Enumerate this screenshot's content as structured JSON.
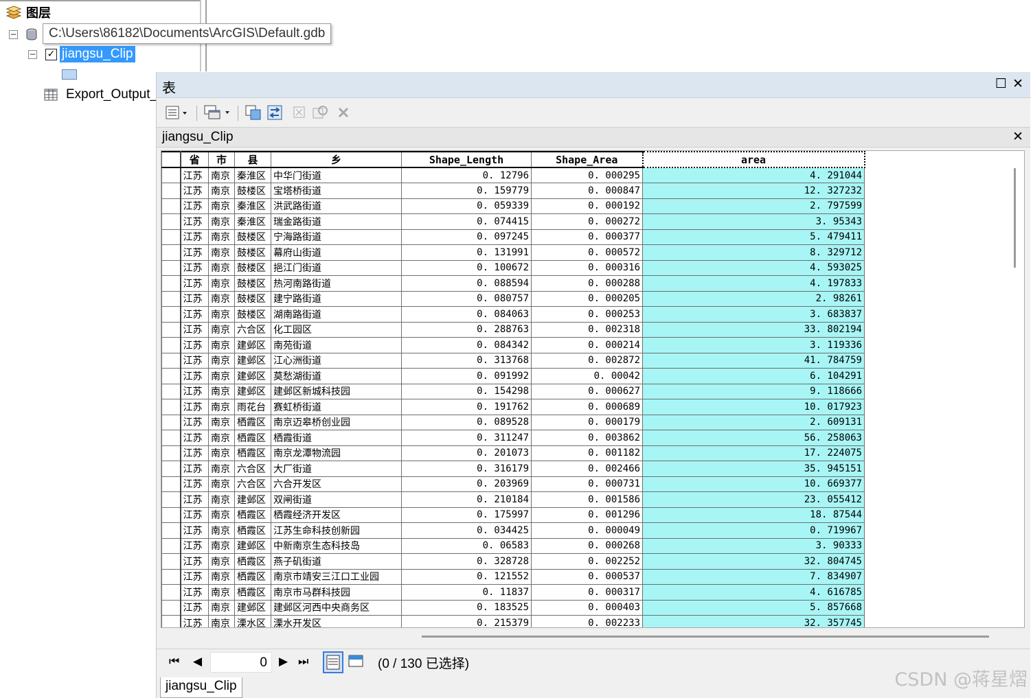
{
  "toc": {
    "title": "图层",
    "gdb_tooltip": "C:\\Users\\86182\\Documents\\ArcGIS\\Default.gdb",
    "layer_name": "jiangsu_Clip",
    "table_name": "Export_Output_",
    "collapse_glyph": "−",
    "check_glyph": "✓"
  },
  "window": {
    "title": "表",
    "maximize_glyph": "☐",
    "close_glyph": "✕",
    "tab_name": "jiangsu_Clip",
    "tab_close_glyph": "✕"
  },
  "toolbar": {
    "icons": [
      "table-options-icon",
      "related-tables-icon",
      "select-by-attributes-icon",
      "switch-selection-icon",
      "clear-selection-icon",
      "zoom-to-selected-icon",
      "delete-selected-icon"
    ]
  },
  "grid": {
    "columns": [
      "省",
      "市",
      "县",
      "乡",
      "Shape_Length",
      "Shape_Area",
      "area"
    ],
    "rows": [
      [
        "江苏",
        "南京",
        "秦淮区",
        "中华门街道",
        "0. 12796",
        "0. 000295",
        "4. 291044"
      ],
      [
        "江苏",
        "南京",
        "鼓楼区",
        "宝塔桥街道",
        "0. 159779",
        "0. 000847",
        "12. 327232"
      ],
      [
        "江苏",
        "南京",
        "秦淮区",
        "洪武路街道",
        "0. 059339",
        "0. 000192",
        "2. 797599"
      ],
      [
        "江苏",
        "南京",
        "秦淮区",
        "瑞金路街道",
        "0. 074415",
        "0. 000272",
        "3. 95343"
      ],
      [
        "江苏",
        "南京",
        "鼓楼区",
        "宁海路街道",
        "0. 097245",
        "0. 000377",
        "5. 479411"
      ],
      [
        "江苏",
        "南京",
        "鼓楼区",
        "幕府山街道",
        "0. 131991",
        "0. 000572",
        "8. 329712"
      ],
      [
        "江苏",
        "南京",
        "鼓楼区",
        "挹江门街道",
        "0. 100672",
        "0. 000316",
        "4. 593025"
      ],
      [
        "江苏",
        "南京",
        "鼓楼区",
        "热河南路街道",
        "0. 088594",
        "0. 000288",
        "4. 197833"
      ],
      [
        "江苏",
        "南京",
        "鼓楼区",
        "建宁路街道",
        "0. 080757",
        "0. 000205",
        "2. 98261"
      ],
      [
        "江苏",
        "南京",
        "鼓楼区",
        "湖南路街道",
        "0. 084063",
        "0. 000253",
        "3. 683837"
      ],
      [
        "江苏",
        "南京",
        "六合区",
        "化工园区",
        "0. 288763",
        "0. 002318",
        "33. 802194"
      ],
      [
        "江苏",
        "南京",
        "建邺区",
        "南苑街道",
        "0. 084342",
        "0. 000214",
        "3. 119336"
      ],
      [
        "江苏",
        "南京",
        "建邺区",
        "江心洲街道",
        "0. 313768",
        "0. 002872",
        "41. 784759"
      ],
      [
        "江苏",
        "南京",
        "建邺区",
        "莫愁湖街道",
        "0. 091992",
        "0. 00042",
        "6. 104291"
      ],
      [
        "江苏",
        "南京",
        "建邺区",
        "建邺区新城科技园",
        "0. 154298",
        "0. 000627",
        "9. 118666"
      ],
      [
        "江苏",
        "南京",
        "雨花台",
        "赛虹桥街道",
        "0. 191762",
        "0. 000689",
        "10. 017923"
      ],
      [
        "江苏",
        "南京",
        "栖霞区",
        "南京迈皋桥创业园",
        "0. 089528",
        "0. 000179",
        "2. 609131"
      ],
      [
        "江苏",
        "南京",
        "栖霞区",
        "栖霞街道",
        "0. 311247",
        "0. 003862",
        "56. 258063"
      ],
      [
        "江苏",
        "南京",
        "栖霞区",
        "南京龙潭物流园",
        "0. 201073",
        "0. 001182",
        "17. 224075"
      ],
      [
        "江苏",
        "南京",
        "六合区",
        "大厂街道",
        "0. 316179",
        "0. 002466",
        "35. 945151"
      ],
      [
        "江苏",
        "南京",
        "六合区",
        "六合开发区",
        "0. 203969",
        "0. 000731",
        "10. 669377"
      ],
      [
        "江苏",
        "南京",
        "建邺区",
        "双闸街道",
        "0. 210184",
        "0. 001586",
        "23. 055412"
      ],
      [
        "江苏",
        "南京",
        "栖霞区",
        "栖霞经济开发区",
        "0. 175997",
        "0. 001296",
        "18. 87544"
      ],
      [
        "江苏",
        "南京",
        "栖霞区",
        "江苏生命科技创新园",
        "0. 034425",
        "0. 000049",
        "0. 719967"
      ],
      [
        "江苏",
        "南京",
        "建邺区",
        "中新南京生态科技岛",
        "0. 06583",
        "0. 000268",
        "3. 90333"
      ],
      [
        "江苏",
        "南京",
        "栖霞区",
        "燕子矶街道",
        "0. 328728",
        "0. 002252",
        "32. 804745"
      ],
      [
        "江苏",
        "南京",
        "栖霞区",
        "南京市靖安三江口工业园",
        "0. 121552",
        "0. 000537",
        "7. 834907"
      ],
      [
        "江苏",
        "南京",
        "栖霞区",
        "南京市马群科技园",
        "0. 11837",
        "0. 000317",
        "4. 616785"
      ],
      [
        "江苏",
        "南京",
        "建邺区",
        "建邺区河西中央商务区",
        "0. 183525",
        "0. 000403",
        "5. 857668"
      ],
      [
        "江苏",
        "南京",
        "溧水区",
        "溧水开发区",
        "0. 215379",
        "0. 002233",
        "32. 357745"
      ]
    ]
  },
  "nav": {
    "first_glyph": "⏮",
    "prev_glyph": "◀",
    "record": "0",
    "next_glyph": "▶",
    "last_glyph": "⏭",
    "status": "(0 / 130 已选择)"
  },
  "bottom_tab": "jiangsu_Clip",
  "watermark": "CSDN @蒋星熠",
  "colors": {
    "area_column": "#a8f5f5",
    "selection": "#3399ff",
    "title_bar": "#dce6f0"
  }
}
